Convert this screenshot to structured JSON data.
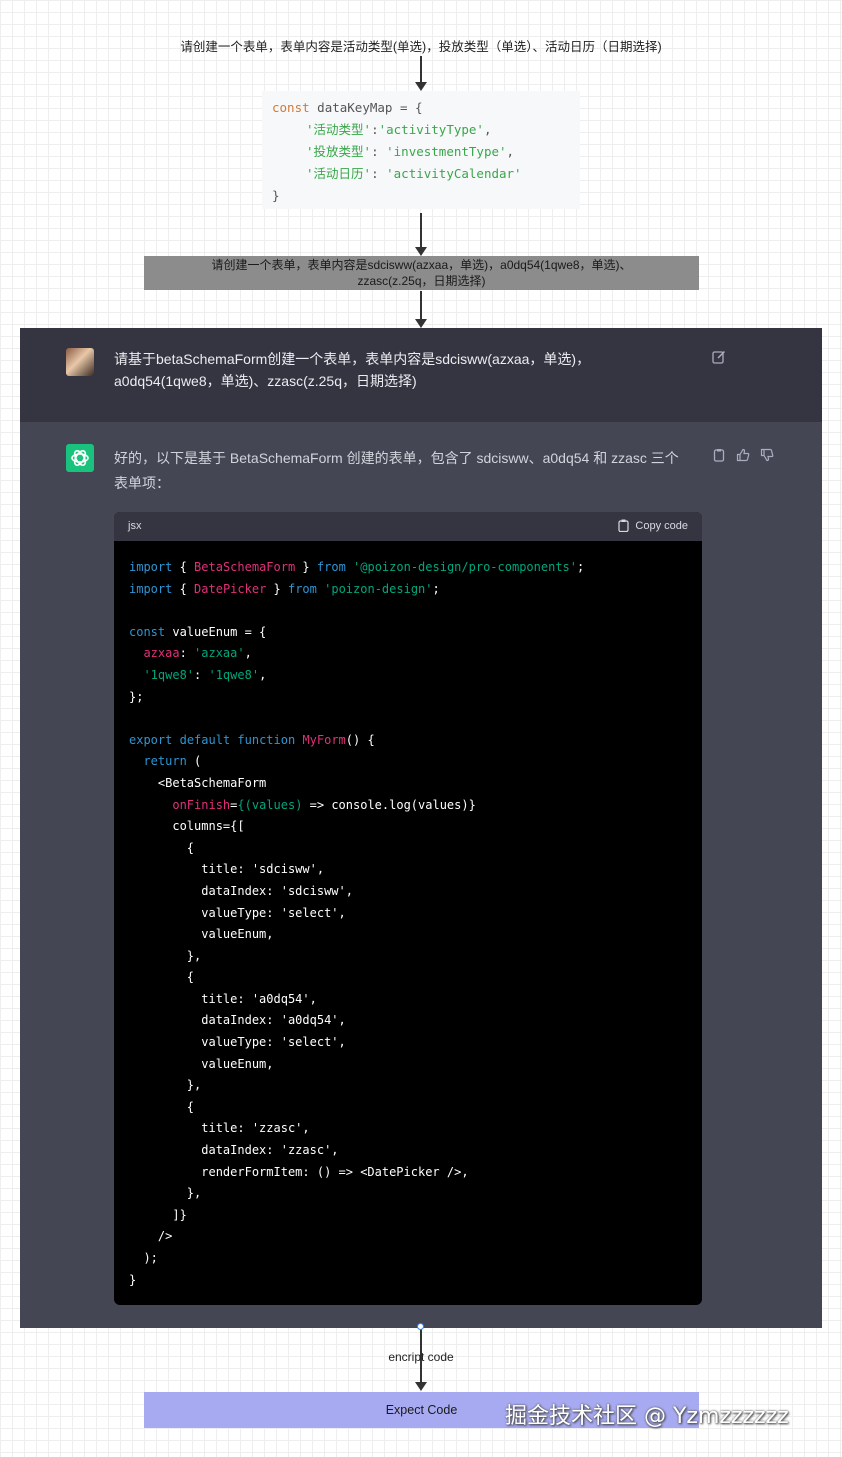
{
  "step1": "请创建一个表单，表单内容是活动类型(单选)，投放类型（单选）、活动日历（日期选择)",
  "map_code": {
    "decl_kw": "const",
    "decl_rest": " dataKeyMap = {",
    "rows": [
      {
        "key": "'活动类型'",
        "sep": ":",
        "val": "'activityType'",
        "end": ","
      },
      {
        "key": "'投放类型'",
        "sep": ": ",
        "val": "'investmentType'",
        "end": ","
      },
      {
        "key": "'活动日历'",
        "sep": ": ",
        "val": "'activityCalendar'",
        "end": ""
      }
    ],
    "close": "}"
  },
  "step2_line1": "请创建一个表单，表单内容是sdcisww(azxaa，单选)，a0dq54(1qwe8，单选)、",
  "step2_line2": "zzasc(z.25q，日期选择)",
  "chat": {
    "user_line1": "请基于betaSchemaForm创建一个表单，表单内容是sdcisww(azxaa，单选)，",
    "user_line2": "a0dq54(1qwe8，单选)、zzasc(z.25q，日期选择)",
    "ai_line1": "好的，以下是基于 BetaSchemaForm 创建的表单，包含了 sdcisww、a0dq54 和 zzasc 三个",
    "ai_line2": "表单项：",
    "code_lang": "jsx",
    "copy_label": "Copy code"
  },
  "code_lines": [
    [
      {
        "t": "import",
        "c": "k"
      },
      {
        "t": " { ",
        "c": "w"
      },
      {
        "t": "BetaSchemaForm",
        "c": "r"
      },
      {
        "t": " } ",
        "c": "w"
      },
      {
        "t": "from",
        "c": "k"
      },
      {
        "t": " ",
        "c": "w"
      },
      {
        "t": "'@poizon-design/pro-components'",
        "c": "s"
      },
      {
        "t": ";",
        "c": "w"
      }
    ],
    [
      {
        "t": "import",
        "c": "k"
      },
      {
        "t": " { ",
        "c": "w"
      },
      {
        "t": "DatePicker",
        "c": "r"
      },
      {
        "t": " } ",
        "c": "w"
      },
      {
        "t": "from",
        "c": "k"
      },
      {
        "t": " ",
        "c": "w"
      },
      {
        "t": "'poizon-design'",
        "c": "s"
      },
      {
        "t": ";",
        "c": "w"
      }
    ],
    [],
    [
      {
        "t": "const",
        "c": "k"
      },
      {
        "t": " valueEnum = {",
        "c": "w"
      }
    ],
    [
      {
        "t": "  ",
        "c": "w"
      },
      {
        "t": "azxaa",
        "c": "r"
      },
      {
        "t": ": ",
        "c": "w"
      },
      {
        "t": "'azxaa'",
        "c": "s"
      },
      {
        "t": ",",
        "c": "w"
      }
    ],
    [
      {
        "t": "  ",
        "c": "w"
      },
      {
        "t": "'1qwe8'",
        "c": "s"
      },
      {
        "t": ": ",
        "c": "w"
      },
      {
        "t": "'1qwe8'",
        "c": "s"
      },
      {
        "t": ",",
        "c": "w"
      }
    ],
    [
      {
        "t": "};",
        "c": "w"
      }
    ],
    [],
    [
      {
        "t": "export",
        "c": "k"
      },
      {
        "t": " ",
        "c": "w"
      },
      {
        "t": "default",
        "c": "k"
      },
      {
        "t": " ",
        "c": "w"
      },
      {
        "t": "function",
        "c": "k"
      },
      {
        "t": " ",
        "c": "w"
      },
      {
        "t": "MyForm",
        "c": "r"
      },
      {
        "t": "() {",
        "c": "w"
      }
    ],
    [
      {
        "t": "  ",
        "c": "w"
      },
      {
        "t": "return",
        "c": "k"
      },
      {
        "t": " (",
        "c": "w"
      }
    ],
    [
      {
        "t": "    <BetaSchemaForm",
        "c": "w"
      }
    ],
    [
      {
        "t": "      ",
        "c": "w"
      },
      {
        "t": "onFinish",
        "c": "r"
      },
      {
        "t": "=",
        "c": "w"
      },
      {
        "t": "{(values)",
        "c": "s"
      },
      {
        "t": " => console.log(values)}",
        "c": "w"
      }
    ],
    [
      {
        "t": "      columns={[",
        "c": "w"
      }
    ],
    [
      {
        "t": "        {",
        "c": "w"
      }
    ],
    [
      {
        "t": "          title: 'sdcisww',",
        "c": "w"
      }
    ],
    [
      {
        "t": "          dataIndex: 'sdcisww',",
        "c": "w"
      }
    ],
    [
      {
        "t": "          valueType: 'select',",
        "c": "w"
      }
    ],
    [
      {
        "t": "          valueEnum,",
        "c": "w"
      }
    ],
    [
      {
        "t": "        },",
        "c": "w"
      }
    ],
    [
      {
        "t": "        {",
        "c": "w"
      }
    ],
    [
      {
        "t": "          title: 'a0dq54',",
        "c": "w"
      }
    ],
    [
      {
        "t": "          dataIndex: 'a0dq54',",
        "c": "w"
      }
    ],
    [
      {
        "t": "          valueType: 'select',",
        "c": "w"
      }
    ],
    [
      {
        "t": "          valueEnum,",
        "c": "w"
      }
    ],
    [
      {
        "t": "        },",
        "c": "w"
      }
    ],
    [
      {
        "t": "        {",
        "c": "w"
      }
    ],
    [
      {
        "t": "          title: 'zzasc',",
        "c": "w"
      }
    ],
    [
      {
        "t": "          dataIndex: 'zzasc',",
        "c": "w"
      }
    ],
    [
      {
        "t": "          renderFormItem: () => <DatePicker />,",
        "c": "w"
      }
    ],
    [
      {
        "t": "        },",
        "c": "w"
      }
    ],
    [
      {
        "t": "      ]}",
        "c": "w"
      }
    ],
    [
      {
        "t": "    />",
        "c": "w"
      }
    ],
    [
      {
        "t": "  );",
        "c": "w"
      }
    ],
    [
      {
        "t": "}",
        "c": "w"
      }
    ]
  ],
  "encrypt_label": "encript code",
  "expect_label": "Expect Code",
  "watermark": "掘金技术社区 @ Yzmzzzzzz"
}
